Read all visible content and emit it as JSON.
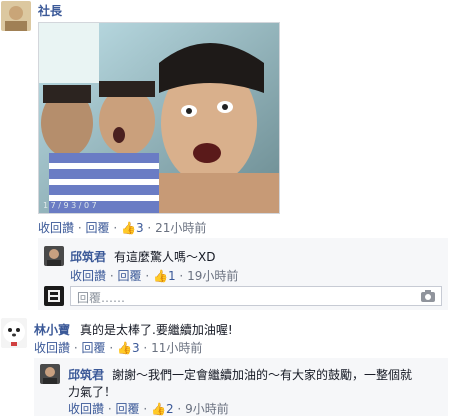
{
  "comment1": {
    "author": "社長",
    "photo_watermark": "1 7 / 9 3 / 0 7",
    "actions": {
      "unlike": "收回讚",
      "reply": "回覆",
      "likes": "3",
      "time": "21小時前"
    }
  },
  "reply1": {
    "author": "邱筑君",
    "text": "有這麼驚人嗎～XD",
    "actions": {
      "unlike": "收回讚",
      "reply": "回覆",
      "likes": "1",
      "time": "19小時前"
    }
  },
  "reply_input": {
    "placeholder": "回覆……"
  },
  "comment2": {
    "author": "林小寶",
    "text": "真的是太棒了.要繼續加油喔!",
    "actions": {
      "unlike": "收回讚",
      "reply": "回覆",
      "likes": "3",
      "time": "11小時前"
    }
  },
  "reply2": {
    "author": "邱筑君",
    "text_line1": "謝謝～我們一定會繼續加油的～有大家的鼓勵，一整個就",
    "text_line2": "力氣了！",
    "actions": {
      "unlike": "收回讚",
      "reply": "回覆",
      "likes": "2",
      "time": "9小時前"
    }
  },
  "separator": "·",
  "like_icon": "thumbs-up-icon",
  "camera_icon": "camera-icon",
  "colors": {
    "link": "#3b5998",
    "meta": "#6a7180",
    "reply_bg": "#f6f7f9"
  }
}
